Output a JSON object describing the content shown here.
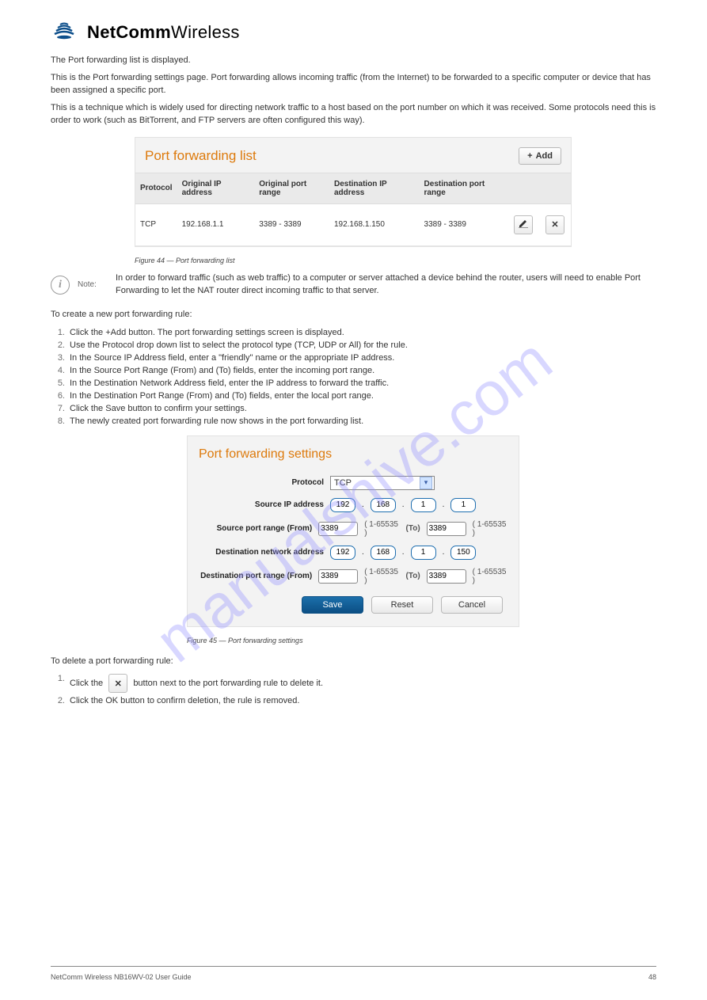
{
  "watermark": "manualshive.com",
  "brand": {
    "bold": "NetComm",
    "light": "Wireless"
  },
  "text": {
    "intro1": "The Port forwarding list is displayed.",
    "intro2": "This is the Port forwarding settings page. Port forwarding allows incoming traffic (from the Internet) to be forwarded to a specific computer or device that has been assigned a specific port.",
    "intro3": "This is a technique which is widely used for directing network traffic to a host based on the port number on which it was received. Some protocols need this is order to work (such as BitTorrent, and FTP servers are often configured this way).",
    "note_label": "Note:",
    "note": "In order to forward traffic (such as web traffic) to a computer or server attached a device behind the router, users will need to enable Port Forwarding to let the NAT router direct incoming traffic to that server.",
    "to_create": "To create a new port forwarding rule:",
    "to_delete": "To delete a port forwarding rule:"
  },
  "list_panel": {
    "title": "Port forwarding list",
    "add_label": "Add",
    "headers": {
      "protocol": "Protocol",
      "orig_ip": "Original IP address",
      "orig_port": "Original port range",
      "dest_ip": "Destination IP address",
      "dest_port": "Destination port range"
    },
    "row": {
      "protocol": "TCP",
      "orig_ip": "192.168.1.1",
      "orig_port": "3389 - 3389",
      "dest_ip": "192.168.1.150",
      "dest_port": "3389 - 3389"
    }
  },
  "captions": {
    "fig1": "Figure 44 — Port forwarding list",
    "fig2": "Figure 45 — Port forwarding settings"
  },
  "steps1": [
    "Click the +Add button. The port forwarding settings screen is displayed.",
    "Use the Protocol drop down list to select the protocol type (TCP, UDP or All) for the rule.",
    "In the Source IP Address field, enter a \"friendly\" name or the appropriate IP address.",
    "In the Source Port Range (From) and (To) fields, enter the incoming port range.",
    "In the Destination Network Address field, enter the IP address to forward the traffic.",
    "In the Destination Port Range (From) and (To) fields, enter the local port range.",
    "Click the Save button to confirm your settings.",
    "The newly created port forwarding rule now shows in the port forwarding list."
  ],
  "settings_panel": {
    "title": "Port forwarding settings",
    "labels": {
      "protocol": "Protocol",
      "source_ip": "Source IP address",
      "source_port_from": "Source port range (From)",
      "dest_net": "Destination network address",
      "dest_port_from": "Destination port range (From)",
      "to": "(To)"
    },
    "hints": {
      "range": "( 1-65535 )"
    },
    "values": {
      "protocol": "TCP",
      "source_ip": [
        "192",
        "168",
        "1",
        "1"
      ],
      "source_port_from": "3389",
      "source_port_to": "3389",
      "dest_ip": [
        "192",
        "168",
        "1",
        "150"
      ],
      "dest_port_from": "3389",
      "dest_port_to": "3389"
    },
    "buttons": {
      "save": "Save",
      "reset": "Reset",
      "cancel": "Cancel"
    }
  },
  "steps2": {
    "0_a": "Click the",
    "0_b": "button next to the port forwarding rule to delete it.",
    "1": "Click the OK button to confirm deletion, the rule is removed."
  },
  "footer": {
    "left": "NetComm Wireless NB16WV-02 User Guide",
    "right": "48"
  }
}
